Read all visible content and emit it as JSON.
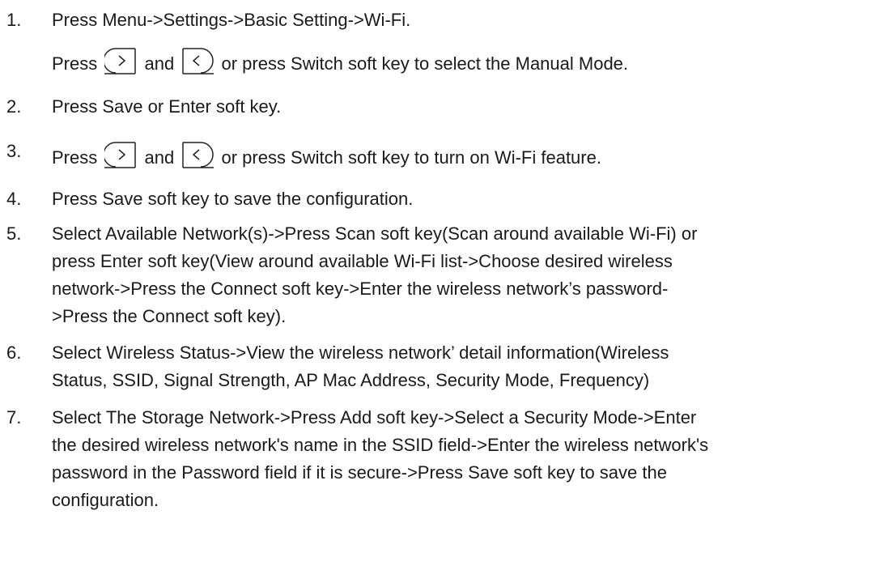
{
  "steps": [
    {
      "number": "1.",
      "lines": [
        "Press Menu->Settings->Basic Setting->Wi-Fi."
      ],
      "subline": {
        "prefix": "Press",
        "middle": "and",
        "suffix": "or press Switch soft key to select the Manual Mode."
      }
    },
    {
      "number": "2.",
      "lines": [
        "Press Save or Enter soft key."
      ]
    },
    {
      "number": "3.",
      "subline": {
        "prefix": "Press",
        "middle": "and",
        "suffix": "or press Switch soft key to turn on Wi-Fi feature."
      }
    },
    {
      "number": "4.",
      "lines": [
        "Press Save soft key to save the configuration."
      ]
    },
    {
      "number": "5.",
      "lines": [
        "Select Available Network(s)->Press Scan soft key(Scan around available Wi-Fi) or",
        "press Enter soft key(View around available Wi-Fi list->Choose desired wireless",
        "network->Press the Connect soft key->Enter the wireless network’s password-",
        ">Press the Connect soft key)."
      ]
    },
    {
      "number": "6.",
      "lines": [
        "Select Wireless Status->View the wireless network’ detail information(Wireless",
        "Status, SSID, Signal Strength, AP Mac Address, Security Mode, Frequency)"
      ]
    },
    {
      "number": "7.",
      "lines": [
        "Select The Storage Network->Press Add soft key->Select a Security Mode->Enter",
        "the desired wireless network's name in the SSID field->Enter the wireless network's",
        "password in the Password field if it is secure->Press Save soft key to save the",
        "configuration."
      ]
    }
  ],
  "icons": {
    "right_key": "right-arrow-key-icon",
    "left_key": "left-arrow-key-icon"
  }
}
